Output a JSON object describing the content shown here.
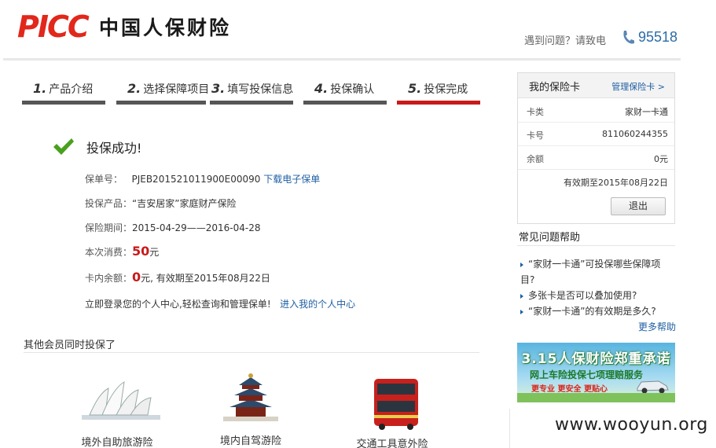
{
  "header": {
    "logo_latin": "PICC",
    "logo_cn": "中国人保财险",
    "help_text": "遇到问题？请致电",
    "phone": "95518"
  },
  "steps": [
    {
      "num": "1.",
      "label": "产品介绍"
    },
    {
      "num": "2.",
      "label": "选择保障项目"
    },
    {
      "num": "3.",
      "label": "填写投保信息"
    },
    {
      "num": "4.",
      "label": "投保确认"
    },
    {
      "num": "5.",
      "label": "投保完成"
    }
  ],
  "success": {
    "title": "投保成功!",
    "policy_label": "保单号：",
    "policy_no": "PJEB201521011900E00090",
    "download_link": "下载电子保单",
    "product_label": "投保产品：",
    "product": "“吉安居家”家庭财产保险",
    "period_label": "保险期间：",
    "period": "2015-04-29——2016-04-28",
    "spend_label": "本次消费：",
    "spend_amount": "50",
    "spend_unit": "元",
    "balance_label": "卡内余额：",
    "balance_amount": "0",
    "balance_suffix": "元, 有效期至2015年08月22日",
    "login_text": "立即登录您的个人中心,轻松查询和管理保单!",
    "center_link": "进入我的个人中心"
  },
  "others": {
    "title": "其他会员同时投保了",
    "products": [
      "境外自助旅游险",
      "境内自驾游险",
      "交通工具意外险"
    ]
  },
  "card": {
    "title": "我的保险卡",
    "manage_link": "管理保险卡 >",
    "rows": [
      {
        "k": "卡类",
        "v": "家财一卡通"
      },
      {
        "k": "卡号",
        "v": "811060244355"
      },
      {
        "k": "余额",
        "v": "0元"
      }
    ],
    "expire": "有效期至2015年08月22日",
    "logout": "退出"
  },
  "faq": {
    "title": "常见问题帮助",
    "items": [
      "“家财一卡通”可投保哪些保障项目?",
      "多张卡是否可以叠加使用?",
      "“家财一卡通”的有效期是多久?"
    ],
    "more": "更多帮助"
  },
  "banner": {
    "title": "3.15人保财险郑重承诺",
    "subtitle": "网上车险投保七项理赔服务",
    "tagline": "更专业 更安全 更贴心"
  },
  "watermark": "www.wooyun.org",
  "colors": {
    "brand_red": "#e2271b",
    "active_step": "#c81a1a",
    "link_blue": "#1f5fa3"
  }
}
